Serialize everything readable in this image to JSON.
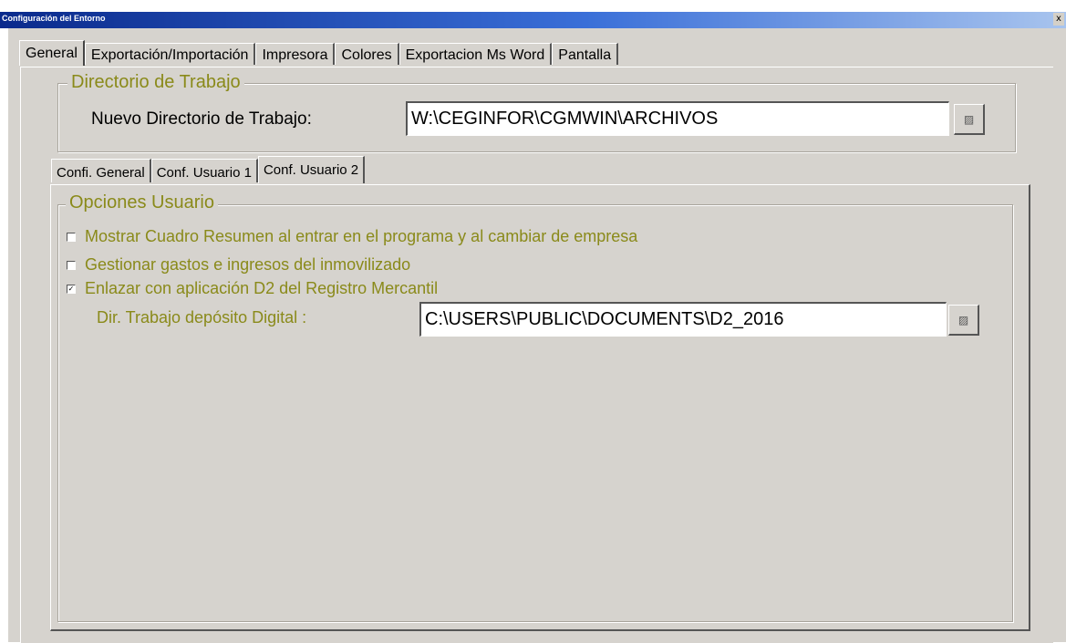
{
  "window": {
    "title": "Configuración del Entorno",
    "close_glyph": "x"
  },
  "tabs": [
    {
      "label": "General",
      "active": true
    },
    {
      "label": "Exportación/Importación"
    },
    {
      "label": "Impresora"
    },
    {
      "label": "Colores"
    },
    {
      "label": "Exportacion Ms Word"
    },
    {
      "label": "Pantalla"
    }
  ],
  "working_dir": {
    "group_title": "Directorio de Trabajo",
    "label": "Nuevo Directorio de Trabajo:",
    "value": "W:\\CEGINFOR\\CGMWIN\\ARCHIVOS",
    "browse_icon": "folder-icon"
  },
  "subtabs": [
    {
      "label": "Confi. General"
    },
    {
      "label": "Conf. Usuario 1"
    },
    {
      "label": "Conf. Usuario 2",
      "active": true
    }
  ],
  "user_options": {
    "group_title": "Opciones Usuario",
    "checkboxes": [
      {
        "label": "Mostrar Cuadro Resumen al entrar en el programa y al cambiar de empresa",
        "checked": false
      },
      {
        "label": "Gestionar gastos e ingresos del inmovilizado",
        "checked": false
      },
      {
        "label": "Enlazar con aplicación D2 del Registro Mercantil",
        "checked": true
      }
    ],
    "digital_dir_label": "Dir. Trabajo depósito Digital :",
    "digital_dir_value": "C:\\USERS\\PUBLIC\\DOCUMENTS\\D2_2016",
    "browse_icon": "folder-icon"
  },
  "colors": {
    "label_olive": "#8a8a1a",
    "window_bg": "#d6d3ce"
  }
}
